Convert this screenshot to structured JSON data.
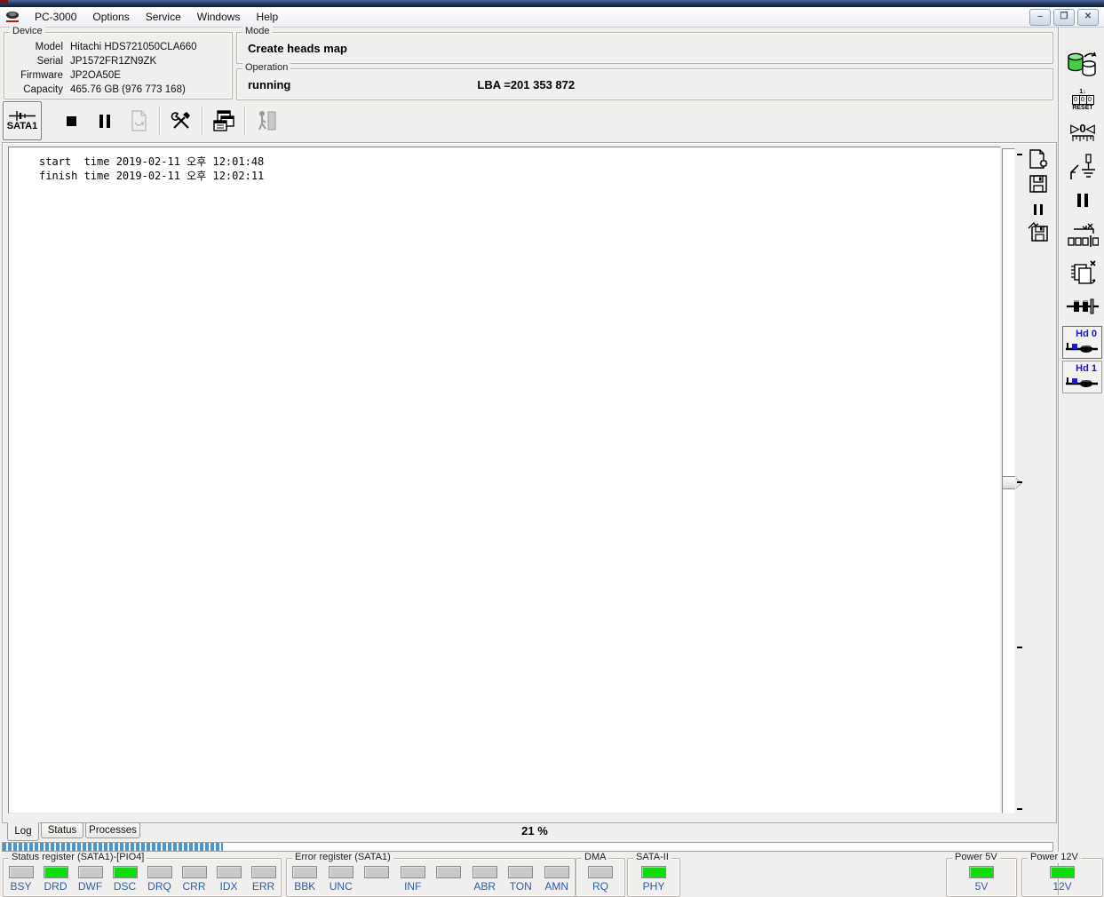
{
  "menu": {
    "items": [
      "PC-3000",
      "Options",
      "Service",
      "Windows",
      "Help"
    ],
    "window_buttons": {
      "minimize": "–",
      "restore": "❐",
      "close": "✕"
    }
  },
  "device": {
    "title": "Device",
    "fields": [
      {
        "label": "Model",
        "value": "Hitachi HDS721050CLA660"
      },
      {
        "label": "Serial",
        "value": "JP1572FR1ZN9ZK"
      },
      {
        "label": "Firmware",
        "value": "JP2OA50E"
      },
      {
        "label": "Capacity",
        "value": "465.76 GB (976 773 168)"
      }
    ]
  },
  "mode": {
    "title": "Mode",
    "value": "Create heads map"
  },
  "operation": {
    "title": "Operation",
    "status": "running",
    "lba": "LBA =201 353 872"
  },
  "toolbar": {
    "port_label": "SATA1"
  },
  "log": {
    "lines": [
      "start  time 2019-02-11 오후 12:01:48",
      "finish time 2019-02-11 오후 12:02:11"
    ]
  },
  "sidebar": {
    "reset_icon": {
      "top": "1↓",
      "digits": [
        "0",
        "0",
        "0"
      ],
      "caption": "RESET"
    },
    "gauge_icon": {
      "text": "▷0◁"
    },
    "hd_buttons": [
      {
        "label": "Hd 0"
      },
      {
        "label": "Hd 1"
      }
    ]
  },
  "tabs": {
    "items": [
      "Log",
      "Status",
      "Processes"
    ],
    "active": "Log"
  },
  "progress": {
    "label": "21 %",
    "percent": 21
  },
  "bottom": {
    "status_register": {
      "title": "Status register (SATA1)-[PIO4]",
      "leds": [
        {
          "label": "BSY",
          "on": false
        },
        {
          "label": "DRD",
          "on": true
        },
        {
          "label": "DWF",
          "on": false
        },
        {
          "label": "DSC",
          "on": true
        },
        {
          "label": "DRQ",
          "on": false
        },
        {
          "label": "CRR",
          "on": false
        },
        {
          "label": "IDX",
          "on": false
        },
        {
          "label": "ERR",
          "on": false
        }
      ]
    },
    "error_register": {
      "title": "Error register (SATA1)",
      "leds": [
        {
          "label": "BBK",
          "on": false
        },
        {
          "label": "UNC",
          "on": false
        },
        {
          "label": "",
          "on": false
        },
        {
          "label": "INF",
          "on": false
        },
        {
          "label": "",
          "on": false
        },
        {
          "label": "ABR",
          "on": false
        },
        {
          "label": "TON",
          "on": false
        },
        {
          "label": "AMN",
          "on": false
        }
      ]
    },
    "dma": {
      "title": "DMA",
      "leds": [
        {
          "label": "RQ",
          "on": false
        }
      ]
    },
    "sata2": {
      "title": "SATA-II",
      "leds": [
        {
          "label": "PHY",
          "on": true
        }
      ]
    },
    "power5": {
      "title": "Power 5V",
      "leds": [
        {
          "label": "5V",
          "on": true
        }
      ]
    },
    "power12": {
      "title": "Power 12V",
      "leds": [
        {
          "label": "12V",
          "on": true
        }
      ]
    }
  },
  "colors": {
    "led_on": "#0ddc0d",
    "led_off": "#c9c9c9",
    "label_blue": "#2a5caa",
    "progress_blue": "#4b95d6",
    "disk_green": "#44cf44"
  }
}
